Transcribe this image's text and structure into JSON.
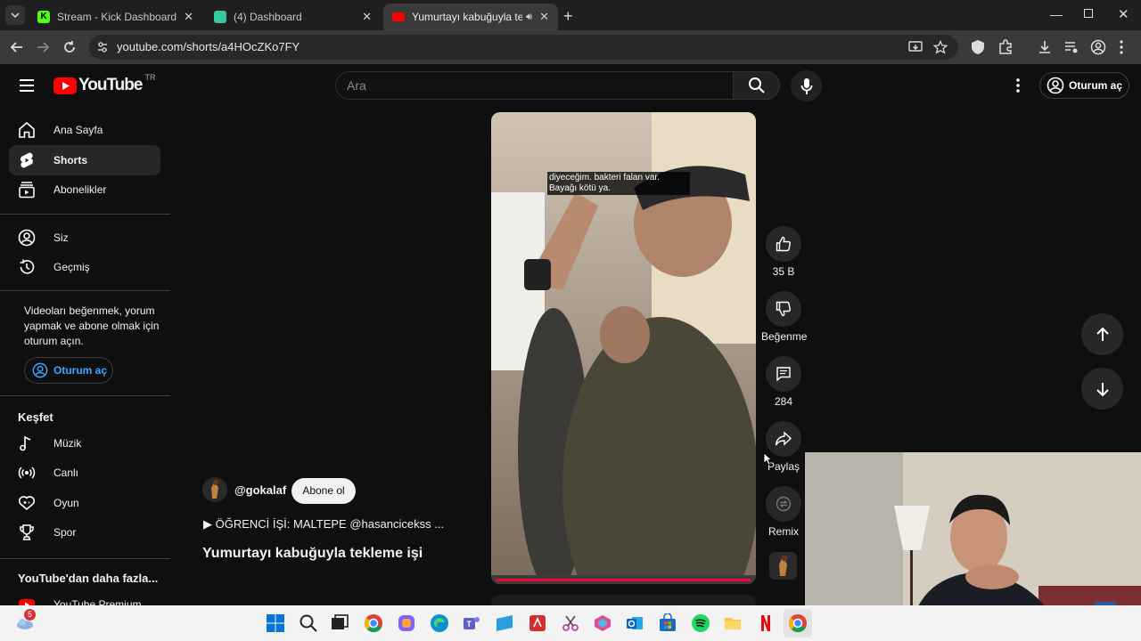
{
  "browser": {
    "tabs": [
      {
        "label": "Stream - Kick Dashboard",
        "favicon_color": "#53fc18"
      },
      {
        "label": "(4) Dashboard",
        "favicon_color": "#37c8a0"
      },
      {
        "label": "Yumurtayı kabuğuyla tekler",
        "favicon_color": "#ff0000"
      }
    ],
    "url": "youtube.com/shorts/a4HOcZKo7FY"
  },
  "youtube": {
    "logo_text": "YouTube",
    "country_code": "TR",
    "search_placeholder": "Ara",
    "signin_label": "Oturum aç",
    "sidebar": {
      "items": [
        {
          "label": "Ana Sayfa",
          "icon": "home-icon"
        },
        {
          "label": "Shorts",
          "icon": "shorts-icon"
        },
        {
          "label": "Abonelikler",
          "icon": "subscriptions-icon"
        },
        {
          "label": "Siz",
          "icon": "user-icon"
        },
        {
          "label": "Geçmiş",
          "icon": "history-icon"
        }
      ],
      "signin_prompt": "Videoları beğenmek, yorum yapmak ve abone olmak için oturum açın.",
      "signin_button": "Oturum aç",
      "explore_heading": "Keşfet",
      "explore_items": [
        {
          "label": "Müzik",
          "icon": "music-icon"
        },
        {
          "label": "Canlı",
          "icon": "live-icon"
        },
        {
          "label": "Oyun",
          "icon": "gaming-icon"
        },
        {
          "label": "Spor",
          "icon": "trophy-icon"
        }
      ],
      "more_heading": "YouTube'dan daha fazla...",
      "more_items": [
        {
          "label": "YouTube Premium"
        }
      ]
    },
    "short": {
      "caption": "diyeceğim. bakteri falan var. Bayağı kötü ya.",
      "channel": "@gokalaf",
      "subscribe_label": "Abone ol",
      "description": "▶ ÖĞRENCİ İŞİ: MALTEPE @hasancicekss ...",
      "title": "Yumurtayı kabuğuyla tekleme işi",
      "likes": "35 B",
      "dislike_label": "Beğenme",
      "comments": "284",
      "share_label": "Paylaş",
      "remix_label": "Remix"
    }
  },
  "taskbar": {
    "weather_badge": "5",
    "apps": [
      "windows-start",
      "search",
      "task-view",
      "chrome",
      "copilot",
      "edge",
      "teams",
      "photos",
      "acrobat",
      "snipping-tool",
      "microsoft-365",
      "outlook",
      "store",
      "spotify",
      "file-explorer",
      "netflix",
      "chrome"
    ]
  }
}
